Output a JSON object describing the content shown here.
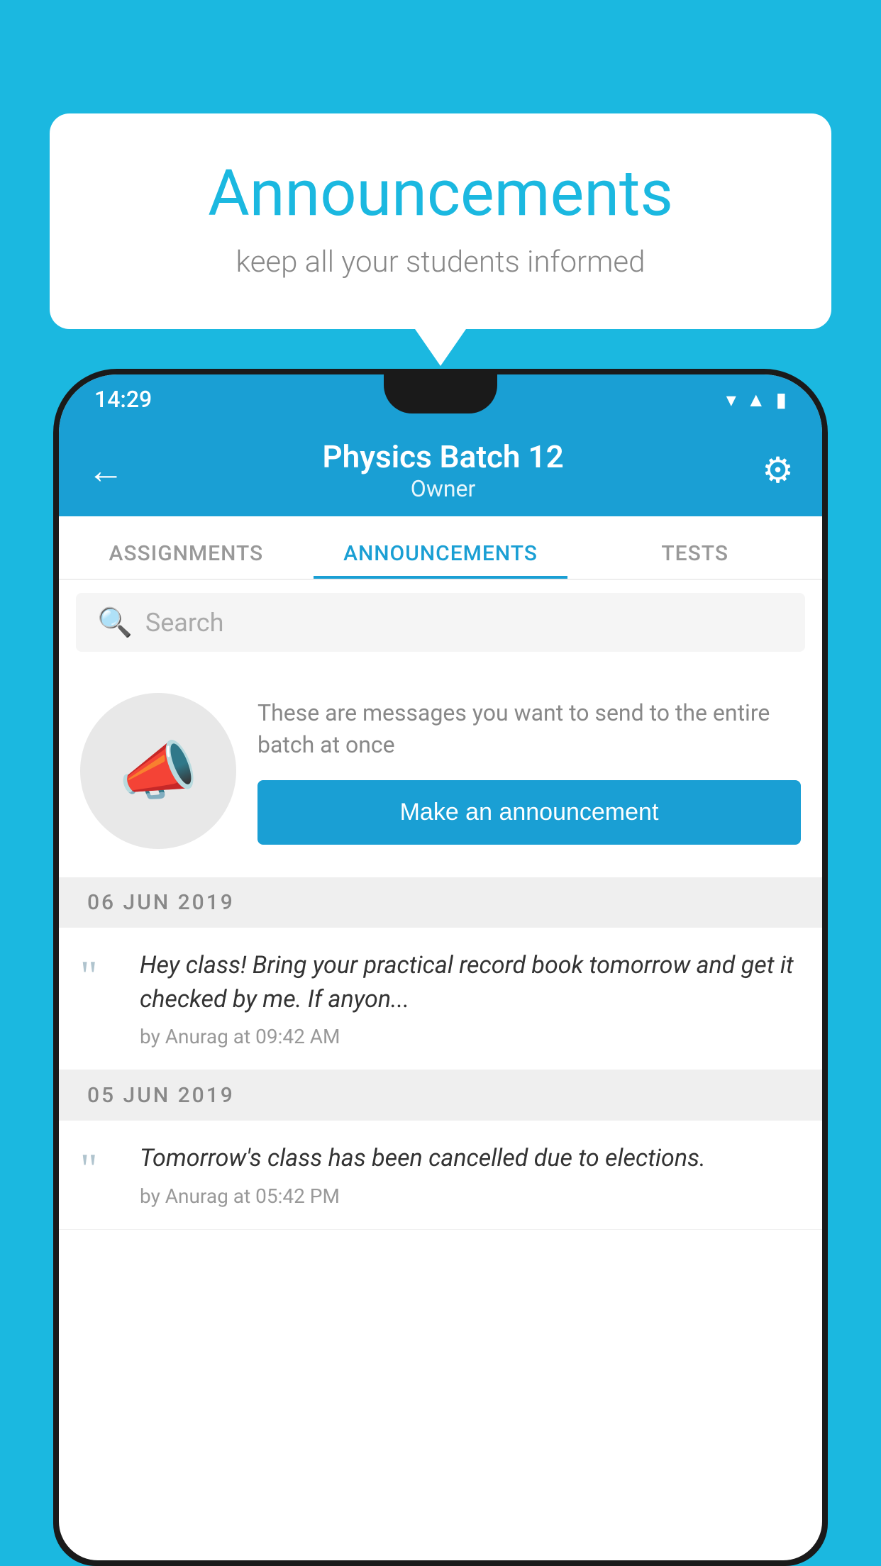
{
  "bubble": {
    "title": "Announcements",
    "subtitle": "keep all your students informed"
  },
  "phone": {
    "status_bar": {
      "time": "14:29",
      "icons": [
        "wifi",
        "signal",
        "battery"
      ]
    },
    "header": {
      "title": "Physics Batch 12",
      "subtitle": "Owner",
      "back_label": "←",
      "gear_label": "⚙"
    },
    "tabs": [
      {
        "label": "ASSIGNMENTS",
        "active": false
      },
      {
        "label": "ANNOUNCEMENTS",
        "active": true
      },
      {
        "label": "TESTS",
        "active": false
      },
      {
        "label": "",
        "active": false
      }
    ],
    "search": {
      "placeholder": "Search"
    },
    "promo": {
      "description": "These are messages you want to send to the entire batch at once",
      "button_label": "Make an announcement"
    },
    "announcements": [
      {
        "date": "06  JUN  2019",
        "text": "Hey class! Bring your practical record book tomorrow and get it checked by me. If anyon...",
        "meta": "by Anurag at 09:42 AM"
      },
      {
        "date": "05  JUN  2019",
        "text": "Tomorrow's class has been cancelled due to elections.",
        "meta": "by Anurag at 05:42 PM"
      }
    ]
  },
  "colors": {
    "primary": "#1a9fd4",
    "background": "#1bb8e0",
    "white": "#ffffff"
  }
}
